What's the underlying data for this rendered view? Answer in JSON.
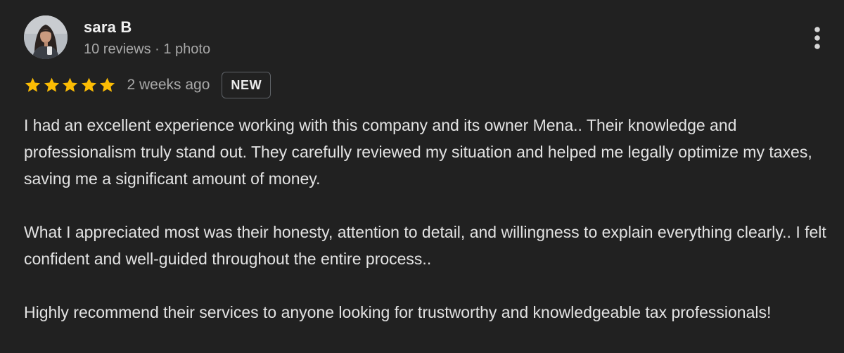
{
  "reviewer": {
    "name": "sara B",
    "meta": "10 reviews · 1 photo"
  },
  "review": {
    "rating": 5,
    "max_rating": 5,
    "date": "2 weeks ago",
    "badge": "NEW",
    "paragraphs": [
      "I had an excellent experience working with this company and its owner Mena.. Their knowledge and professionalism truly stand out. They carefully reviewed my situation and helped me legally optimize my taxes, saving me a significant amount of money.",
      "What I appreciated most was their honesty, attention to detail, and willingness to explain everything clearly.. I felt confident and well-guided throughout the entire process..",
      "Highly recommend their services to anyone looking for trustworthy and knowledgeable tax professionals!"
    ]
  },
  "icons": {
    "menu": "more-vert-icon",
    "star": "star-icon"
  },
  "colors": {
    "background": "#212121",
    "star": "#fbbc04",
    "text": "#e3e3e3",
    "secondary_text": "#a8a8a8"
  }
}
